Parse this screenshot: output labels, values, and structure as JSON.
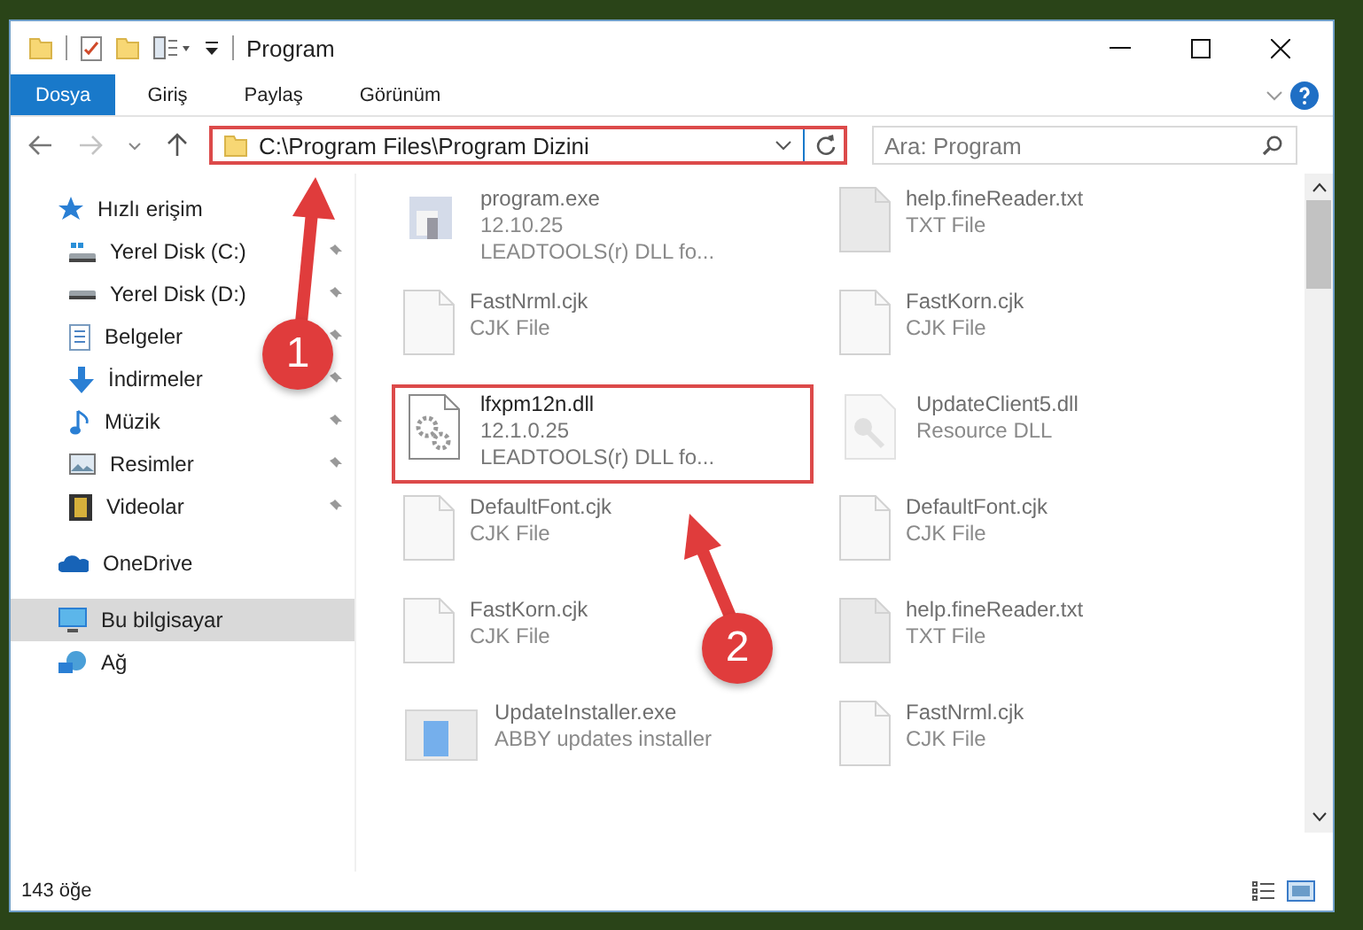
{
  "window": {
    "title": "Program"
  },
  "ribbon_tabs": [
    {
      "label": "Dosya",
      "selected": true
    },
    {
      "label": "Giriş",
      "selected": false
    },
    {
      "label": "Paylaş",
      "selected": false
    },
    {
      "label": "Görünüm",
      "selected": false
    }
  ],
  "address": {
    "path": "C:\\Program Files\\Program Dizini",
    "highlighted": true
  },
  "search": {
    "placeholder": "Ara: Program"
  },
  "nav": [
    {
      "label": "Hızlı erişim",
      "kind": "star",
      "selected": false,
      "children": [
        {
          "label": "Yerel Disk (C:)",
          "kind": "drive-c",
          "selected": false
        },
        {
          "label": "Yerel Disk (D:)",
          "kind": "drive",
          "selected": false
        },
        {
          "label": "Belgeler",
          "kind": "documents",
          "selected": false
        },
        {
          "label": "İndirmeler",
          "kind": "download",
          "selected": false
        },
        {
          "label": "Müzik",
          "kind": "music",
          "selected": false
        },
        {
          "label": "Resimler",
          "kind": "pictures",
          "selected": false
        },
        {
          "label": "Videolar",
          "kind": "videos",
          "selected": false
        }
      ]
    },
    {
      "label": "OneDrive",
      "kind": "cloud",
      "selected": false
    },
    {
      "label": "Bu bilgisayar",
      "kind": "pc",
      "selected": true
    },
    {
      "label": "Ağ",
      "kind": "network",
      "selected": false
    }
  ],
  "files": [
    {
      "name": "program.exe",
      "line_2": "12.10.25",
      "line_3": "LEADTOOLS(r) DLL fo...",
      "kind": "app",
      "blurred": true,
      "highlighted": false
    },
    {
      "name": "help.fineReader.txt",
      "line_2": "TXT File",
      "kind": "txt",
      "blurred": true,
      "highlighted": false
    },
    {
      "name": "FastNrml.cjk",
      "line_2": "CJK File",
      "kind": "doc",
      "blurred": true,
      "highlighted": false
    },
    {
      "name": "FastKorn.cjk",
      "line_2": "CJK File",
      "kind": "doc",
      "blurred": true,
      "highlighted": false
    },
    {
      "name": "lfxpm12n.dll",
      "line_2": "12.1.0.25",
      "line_3": "LEADTOOLS(r) DLL fo...",
      "kind": "gears",
      "blurred": false,
      "highlighted": true
    },
    {
      "name": "UpdateClient5.dll",
      "line_2": "Resource DLL",
      "kind": "key",
      "blurred": true,
      "highlighted": false
    },
    {
      "name": "DefaultFont.cjk",
      "line_2": "CJK File",
      "kind": "doc",
      "blurred": true,
      "highlighted": false
    },
    {
      "name": "DefaultFont.cjk",
      "line_2": "CJK File",
      "kind": "doc",
      "blurred": true,
      "highlighted": false
    },
    {
      "name": "FastKorn.cjk",
      "line_2": "CJK File",
      "kind": "doc",
      "blurred": true,
      "highlighted": false
    },
    {
      "name": "help.fineReader.txt",
      "line_2": "TXT File",
      "kind": "txt",
      "blurred": true,
      "highlighted": false
    },
    {
      "name": "UpdateInstaller.exe",
      "line_2": "ABBY updates installer",
      "kind": "installer",
      "blurred": true,
      "highlighted": false
    },
    {
      "name": "FastNrml.cjk",
      "line_2": "CJK File",
      "kind": "doc",
      "blurred": true,
      "highlighted": false
    }
  ],
  "annotations": [
    {
      "label": "1"
    },
    {
      "label": "2"
    }
  ],
  "status_bar": {
    "count": "143 öğe"
  }
}
